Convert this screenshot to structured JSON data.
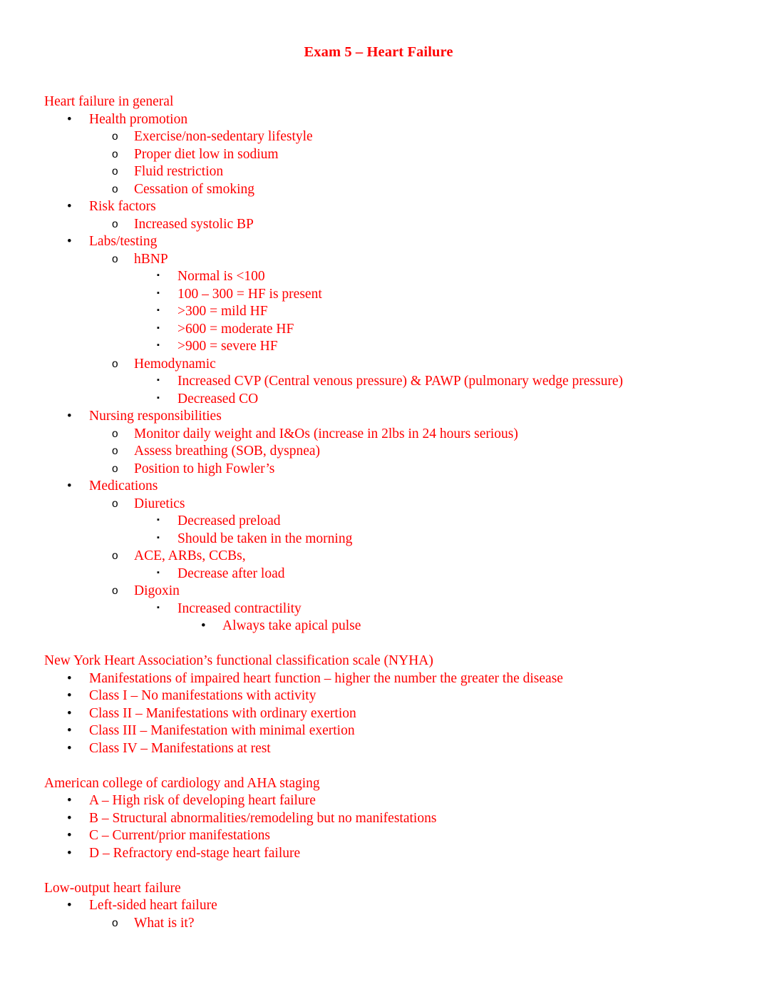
{
  "document": {
    "title": "Exam 5 – Heart Failure",
    "text_color": "#FF0000",
    "bullet_color": "#000000",
    "background_color": "#FFFFFF"
  },
  "bullets": {
    "disc": "•",
    "circle": "o",
    "square": "▪"
  },
  "sections": [
    {
      "heading": "Heart failure in general",
      "items": [
        {
          "level": 1,
          "text": "Health promotion"
        },
        {
          "level": 2,
          "text": "Exercise/non-sedentary lifestyle"
        },
        {
          "level": 2,
          "text": "Proper diet low in sodium"
        },
        {
          "level": 2,
          "text": "Fluid restriction"
        },
        {
          "level": 2,
          "text": "Cessation of smoking"
        },
        {
          "level": 1,
          "text": "Risk factors"
        },
        {
          "level": 2,
          "text": "Increased systolic BP"
        },
        {
          "level": 1,
          "text": "Labs/testing"
        },
        {
          "level": 2,
          "text": "hBNP"
        },
        {
          "level": 3,
          "text": "Normal is <100"
        },
        {
          "level": 3,
          "text": "100 – 300 = HF is present"
        },
        {
          "level": 3,
          "text": ">300 = mild HF"
        },
        {
          "level": 3,
          "text": ">600 = moderate HF"
        },
        {
          "level": 3,
          "text": ">900 = severe HF"
        },
        {
          "level": 2,
          "text": "Hemodynamic"
        },
        {
          "level": 3,
          "text": "Increased CVP (Central venous pressure) & PAWP (pulmonary wedge pressure)"
        },
        {
          "level": 3,
          "text": "Decreased CO"
        },
        {
          "level": 1,
          "text": "Nursing responsibilities"
        },
        {
          "level": 2,
          "text": "Monitor daily weight and I&Os (increase in 2lbs in 24 hours serious)"
        },
        {
          "level": 2,
          "text": "Assess breathing (SOB, dyspnea)"
        },
        {
          "level": 2,
          "text": "Position to high Fowler’s"
        },
        {
          "level": 1,
          "text": "Medications"
        },
        {
          "level": 2,
          "text": "Diuretics"
        },
        {
          "level": 3,
          "text": "Decreased preload"
        },
        {
          "level": 3,
          "text": "Should be taken in the morning"
        },
        {
          "level": 2,
          "text": "ACE, ARBs, CCBs,"
        },
        {
          "level": 3,
          "text": "Decrease after load"
        },
        {
          "level": 2,
          "text": "Digoxin"
        },
        {
          "level": 3,
          "text": "Increased contractility"
        },
        {
          "level": 4,
          "text": "Always take apical pulse"
        }
      ]
    },
    {
      "heading": "New York Heart Association’s functional classification scale (NYHA)",
      "items": [
        {
          "level": 1,
          "text": "Manifestations of impaired heart function – higher the number the greater the disease"
        },
        {
          "level": 1,
          "text": "Class I – No manifestations with activity"
        },
        {
          "level": 1,
          "text": "Class II – Manifestations with ordinary exertion"
        },
        {
          "level": 1,
          "text": "Class III – Manifestation with minimal exertion"
        },
        {
          "level": 1,
          "text": "Class IV – Manifestations at rest"
        }
      ]
    },
    {
      "heading": "American college of cardiology and AHA staging",
      "items": [
        {
          "level": 1,
          "text": "A – High risk of developing heart failure"
        },
        {
          "level": 1,
          "text": "B – Structural abnormalities/remodeling but no manifestations"
        },
        {
          "level": 1,
          "text": "C – Current/prior manifestations"
        },
        {
          "level": 1,
          "text": "D – Refractory end-stage heart failure"
        }
      ]
    },
    {
      "heading": "Low-output heart failure",
      "items": [
        {
          "level": 1,
          "text": "Left-sided heart failure"
        },
        {
          "level": 2,
          "text": "What is it?"
        }
      ]
    }
  ]
}
